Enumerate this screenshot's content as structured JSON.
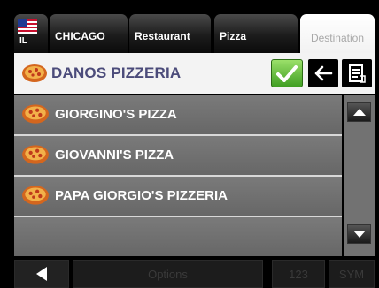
{
  "tabs": {
    "state": {
      "code": "IL"
    },
    "items": [
      {
        "label": "CHICAGO"
      },
      {
        "label": "Restaurant"
      },
      {
        "label": "Pizza"
      },
      {
        "label": "Destination"
      }
    ]
  },
  "header": {
    "title": "DANOS PIZZERIA",
    "icon": "pizza-icon",
    "buttons": [
      "confirm-check-icon",
      "backspace-arrow-icon",
      "list-view-icon"
    ]
  },
  "results": [
    {
      "label": "GIORGINO'S PIZZA"
    },
    {
      "label": "GIOVANNI'S PIZZA"
    },
    {
      "label": "PAPA GIORGIO'S PIZZERIA"
    }
  ],
  "bottom_bar": {
    "options_label": "Options",
    "numbers_label": "123",
    "symbols_label": "SYM"
  },
  "colors": {
    "accent_green": "#55b832",
    "title_color": "#4b4b7a",
    "row_background": "#707070"
  }
}
